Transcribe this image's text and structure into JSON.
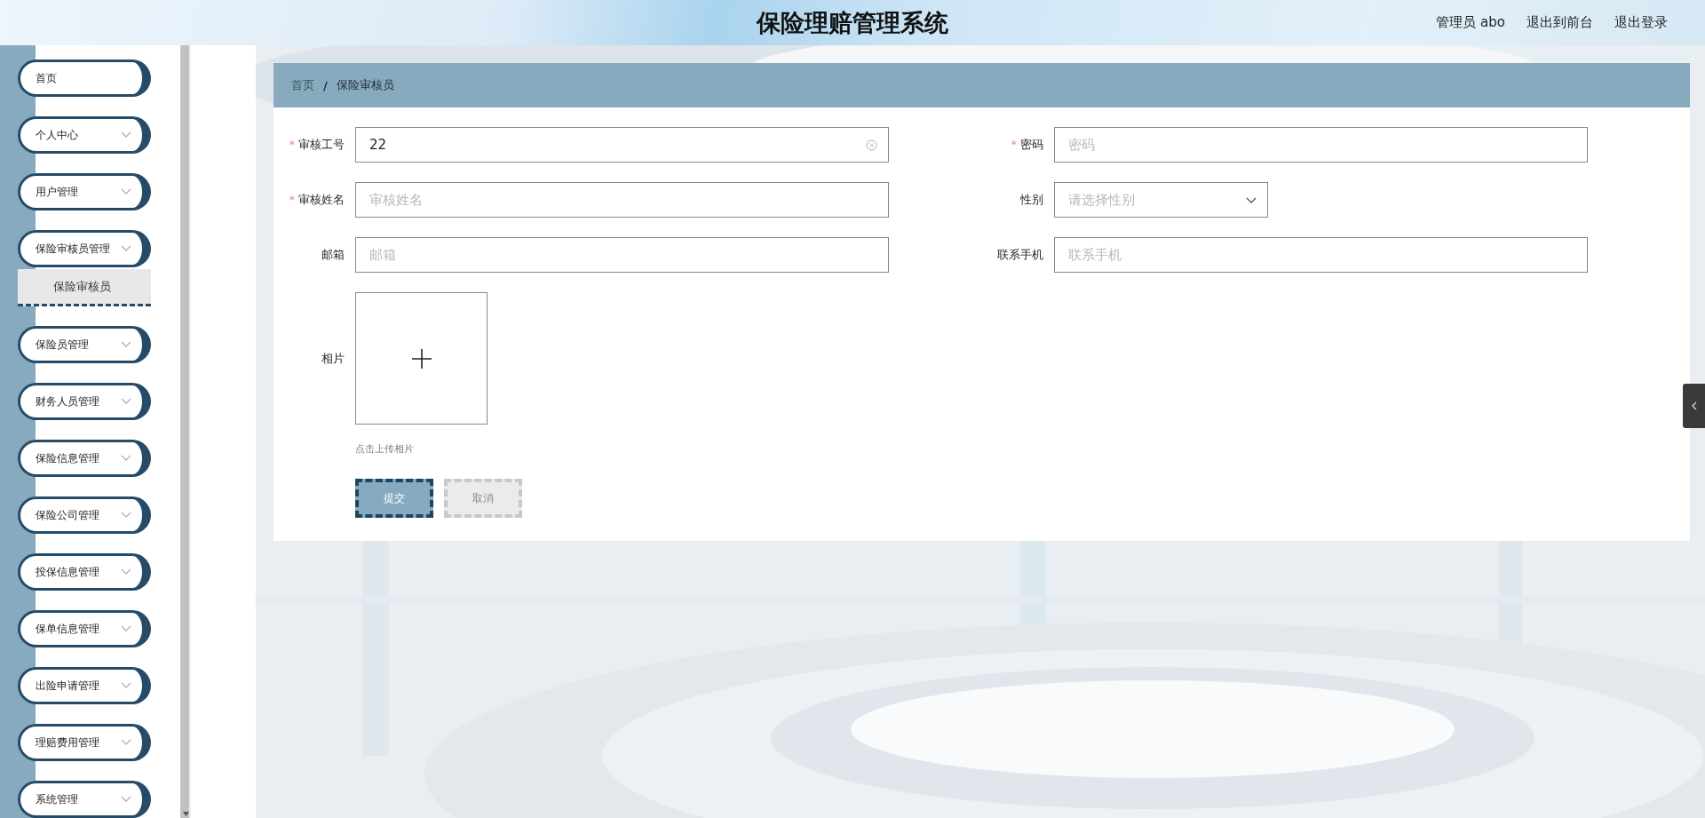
{
  "header": {
    "title": "保险理赔管理系统",
    "links": [
      "管理员 abo",
      "退出到前台",
      "退出登录"
    ]
  },
  "sidebar": {
    "items": [
      {
        "label": "首页",
        "kind": "link"
      },
      {
        "label": "个人中心",
        "kind": "menu"
      },
      {
        "label": "用户管理",
        "kind": "menu"
      },
      {
        "label": "保险审核员管理",
        "kind": "menu",
        "children": [
          {
            "label": "保险审核员",
            "selected": true
          }
        ]
      },
      {
        "label": "保险员管理",
        "kind": "menu"
      },
      {
        "label": "财务人员管理",
        "kind": "menu"
      },
      {
        "label": "保险信息管理",
        "kind": "menu"
      },
      {
        "label": "保险公司管理",
        "kind": "menu"
      },
      {
        "label": "投保信息管理",
        "kind": "menu"
      },
      {
        "label": "保单信息管理",
        "kind": "menu"
      },
      {
        "label": "出险申请管理",
        "kind": "menu"
      },
      {
        "label": "理赔费用管理",
        "kind": "menu"
      },
      {
        "label": "系统管理",
        "kind": "menu"
      }
    ]
  },
  "breadcrumb": {
    "separator": "/",
    "items": [
      "首页",
      "保险审核员"
    ]
  },
  "form": {
    "fields": [
      {
        "label": "审核工号",
        "kind": "text",
        "required_mark": "*",
        "value": "22"
      },
      {
        "label": "密码",
        "kind": "text",
        "required_mark": "*",
        "placeholder": "密码"
      },
      {
        "label": "审核姓名",
        "kind": "text",
        "required_mark": "*",
        "placeholder": "审核姓名"
      },
      {
        "label": "性别",
        "kind": "select",
        "placeholder": "请选择性别"
      },
      {
        "label": "邮箱",
        "kind": "text",
        "placeholder": "邮箱"
      },
      {
        "label": "联系手机",
        "kind": "text",
        "placeholder": "联系手机"
      },
      {
        "label": "相片",
        "kind": "upload",
        "hint": "点击上传相片"
      }
    ],
    "buttons": [
      {
        "label": "提交",
        "kind": "primary"
      },
      {
        "label": "取消",
        "kind": "cancel"
      }
    ]
  }
}
